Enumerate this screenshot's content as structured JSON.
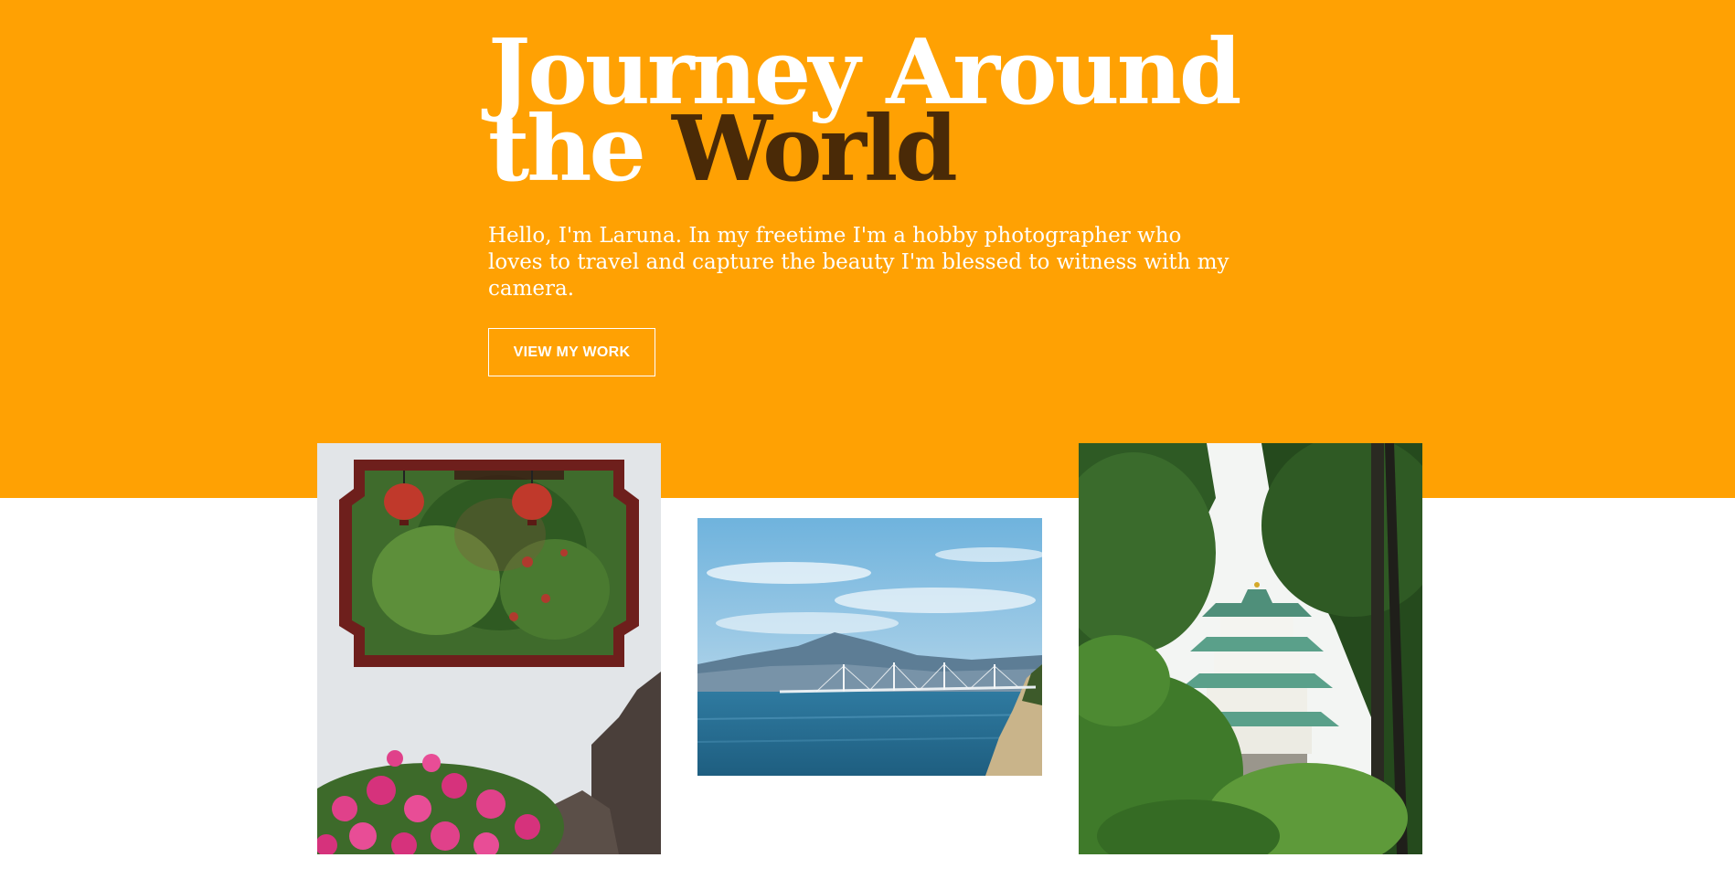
{
  "colors": {
    "hero_bg": "#ffa103",
    "title_white": "#ffffff",
    "title_accent": "#4a2a07",
    "page_bg": "#ffffff"
  },
  "hero": {
    "title_line1": "Journey Around",
    "title_line2_plain": "the",
    "title_line2_accent": "World",
    "intro": "Hello, I'm Laruna. In my freetime I'm a hobby photographer who loves to travel and capture the beauty I'm blessed to witness with my camera.",
    "cta_label": "VIEW MY WORK"
  },
  "gallery": {
    "photos": [
      {
        "subject": "garden-window-photo"
      },
      {
        "subject": "bridge-seascape-photo"
      },
      {
        "subject": "castle-in-trees-photo"
      }
    ]
  }
}
